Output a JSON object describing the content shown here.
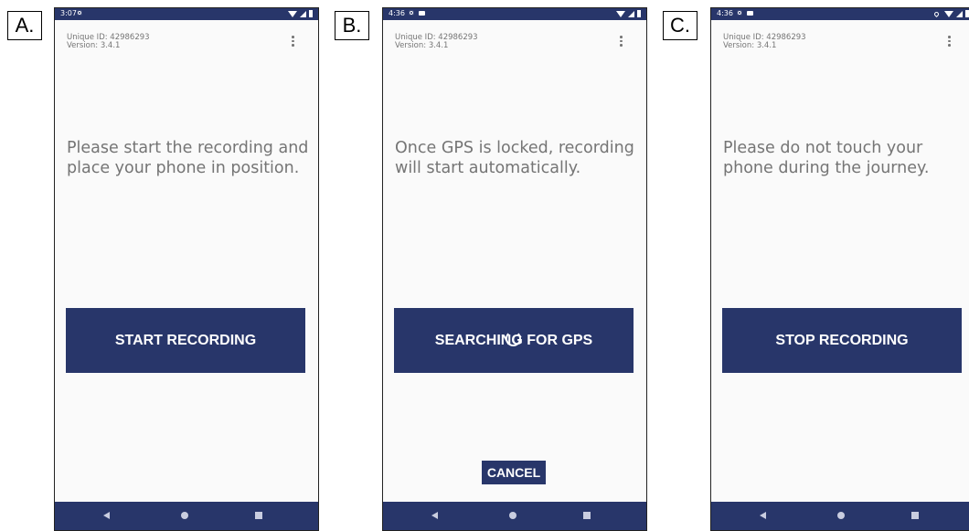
{
  "panels": [
    {
      "label": "A.",
      "status_time": "3:07",
      "unique_id": "Unique ID:  42986293",
      "version": "Version: 3.4.1",
      "message": "Please start the recording and place your phone in position.",
      "button_label": "START RECORDING"
    },
    {
      "label": "B.",
      "status_time": "4:36",
      "unique_id": "Unique ID:  42986293",
      "version": "Version: 3.4.1",
      "message": "Once GPS is locked, recording will start automatically.",
      "button_label": "SEARCHING FOR GPS",
      "cancel_label": "CANCEL"
    },
    {
      "label": "C.",
      "status_time": "4:36",
      "unique_id": "Unique ID:  42986293",
      "version": "Version: 3.4.1",
      "message": "Please do not touch your phone during the journey.",
      "button_label": "STOP RECORDING"
    }
  ],
  "icons": {
    "status_left": [
      "settings-icon",
      "recorder-icon"
    ],
    "status_right": [
      "location-icon",
      "wifi-icon",
      "signal-icon",
      "battery-icon"
    ],
    "overflow_menu": "more-vert-icon",
    "nav": [
      "back-icon",
      "home-icon",
      "recents-icon"
    ],
    "spinner": "loading-spinner-icon"
  },
  "colors": {
    "primary": "#28366a",
    "background": "#fafafa",
    "text_secondary": "#757575"
  }
}
